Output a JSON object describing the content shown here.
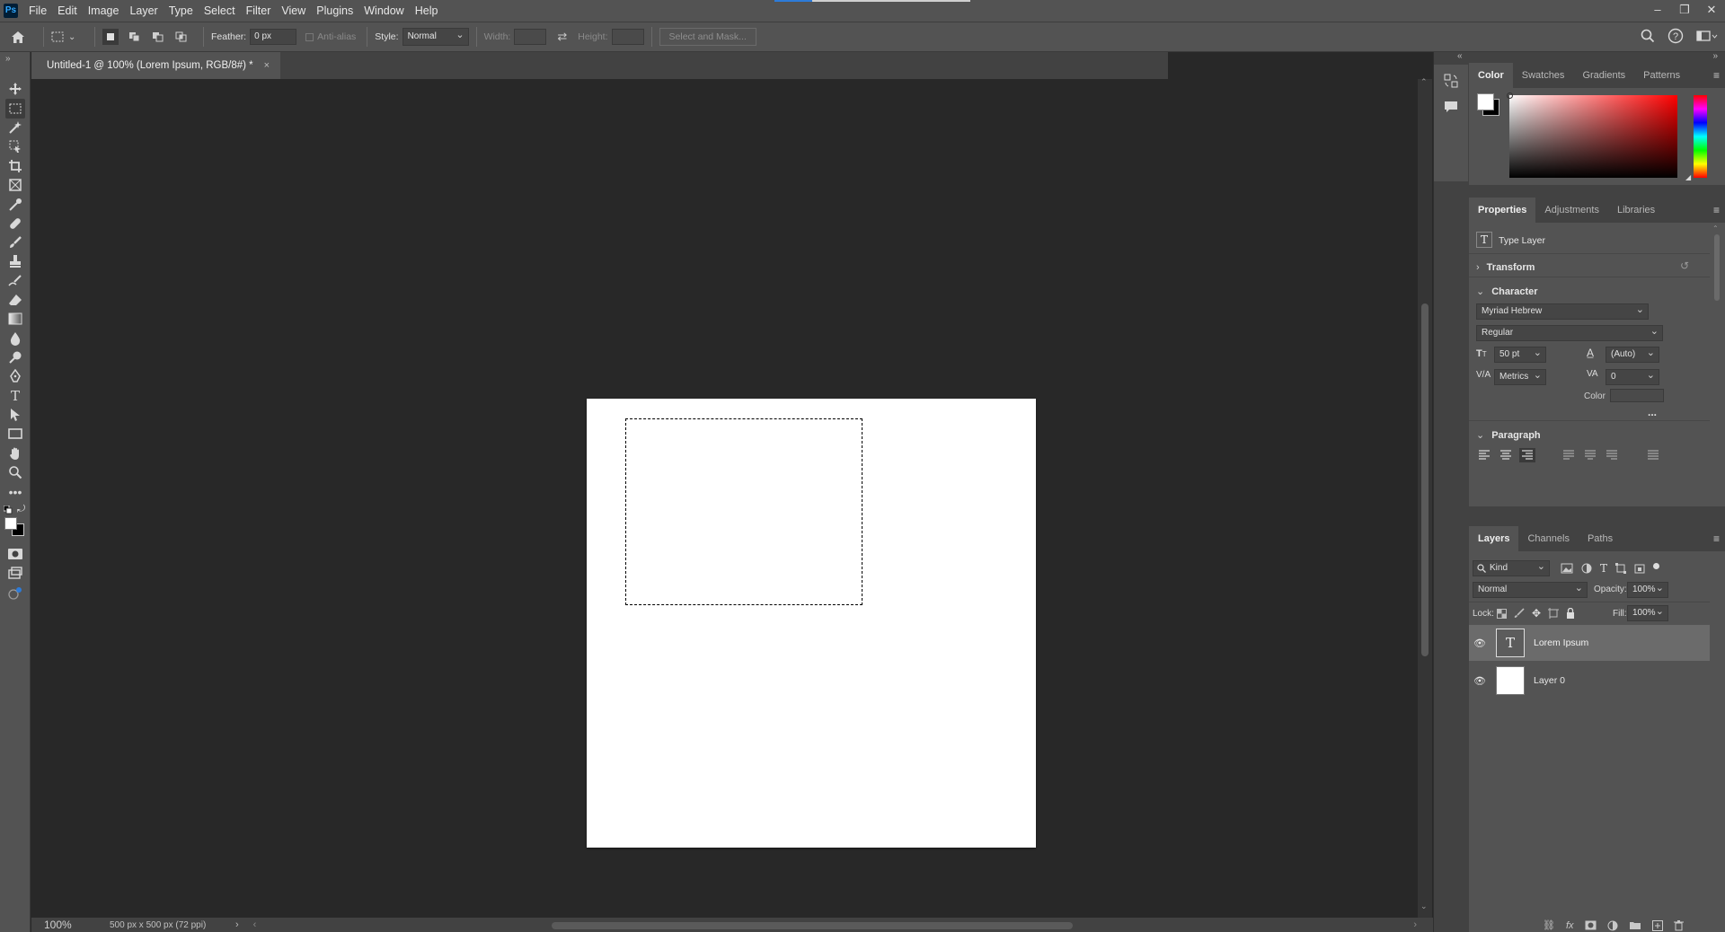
{
  "app": {
    "logo": "Ps"
  },
  "menu": [
    "File",
    "Edit",
    "Image",
    "Layer",
    "Type",
    "Select",
    "Filter",
    "View",
    "Plugins",
    "Window",
    "Help"
  ],
  "window_controls": {
    "minimize": "–",
    "restore": "❐",
    "close": "✕"
  },
  "options": {
    "feather_label": "Feather:",
    "feather_value": "0 px",
    "antialias_label": "Anti-alias",
    "style_label": "Style:",
    "style_value": "Normal",
    "width_label": "Width:",
    "height_label": "Height:",
    "select_mask_label": "Select and Mask..."
  },
  "document": {
    "tab_title": "Untitled-1 @ 100% (Lorem Ipsum, RGB/8#) *",
    "close": "×"
  },
  "status": {
    "zoom": "100%",
    "doc_info": "500 px x 500 px (72 ppi)"
  },
  "color_panel": {
    "tabs": [
      "Color",
      "Swatches",
      "Gradients",
      "Patterns"
    ]
  },
  "properties_panel": {
    "tabs": [
      "Properties",
      "Adjustments",
      "Libraries"
    ],
    "layer_type": "Type Layer",
    "transform_label": "Transform",
    "character_label": "Character",
    "font_family": "Myriad Hebrew",
    "font_style": "Regular",
    "font_size": "50 pt",
    "leading": "(Auto)",
    "kerning": "Metrics",
    "tracking": "0",
    "color_label": "Color",
    "more": "...",
    "paragraph_label": "Paragraph"
  },
  "layers_panel": {
    "tabs": [
      "Layers",
      "Channels",
      "Paths"
    ],
    "filter_kind": "Kind",
    "blend_mode": "Normal",
    "opacity_label": "Opacity:",
    "opacity_value": "100%",
    "lock_label": "Lock:",
    "fill_label": "Fill:",
    "fill_value": "100%",
    "layers": [
      {
        "name": "Lorem Ipsum",
        "type": "text",
        "selected": true
      },
      {
        "name": "Layer 0",
        "type": "pixel",
        "selected": false
      }
    ]
  },
  "colors": {
    "accent_blue": "#2d7bd8",
    "panel_bg": "#535353",
    "canvas_bg": "#282828",
    "hue_base": "#ff0000"
  }
}
